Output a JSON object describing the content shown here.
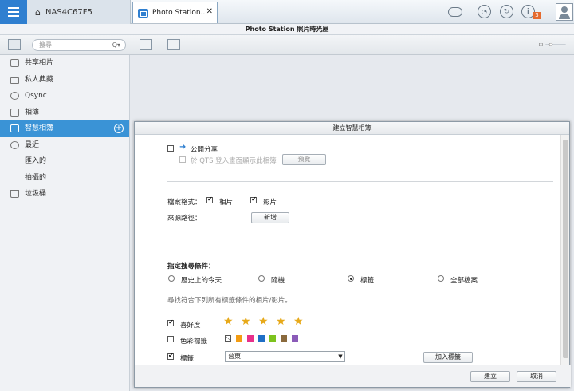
{
  "topbar": {
    "nas_name": "NAS4C67F5",
    "app_tab_label": "Photo Station...",
    "app_tab_close": "✕",
    "notification_count": "3"
  },
  "titlebar": {
    "title": "Photo Station 照片時光屋"
  },
  "toolbar": {
    "search_placeholder": "搜尋",
    "search_icon": "Q▾"
  },
  "sidebar": {
    "items": [
      {
        "label": "共享相片",
        "icon": "shared-photos-icon"
      },
      {
        "label": "私人典藏",
        "icon": "lock-icon"
      },
      {
        "label": "Qsync",
        "icon": "qsync-icon"
      },
      {
        "label": "相簿",
        "icon": "album-icon"
      },
      {
        "label": "智慧相簿",
        "icon": "smart-album-icon"
      },
      {
        "label": "最近",
        "icon": "clock-icon"
      },
      {
        "label": "匯入的"
      },
      {
        "label": "拍攝的"
      },
      {
        "label": "垃圾桶",
        "icon": "trash-icon"
      }
    ]
  },
  "dialog": {
    "title": "建立智慧相簿",
    "public_share_label": "公開分享",
    "qts_login_label": "於 QTS 登入畫面顯示此相簿",
    "preview_button": "預覽",
    "file_format_label": "檔案格式：",
    "photo_label": "相片",
    "video_label": "影片",
    "source_path_label": "來源路徑：",
    "add_button": "新增",
    "search_criteria_label": "指定搜尋條件：",
    "options": [
      "歷史上的今天",
      "隨機",
      "標籤",
      "全部檔案"
    ],
    "selected_option": "標籤",
    "hint": "尋找符合下列所有標籤條件的相片/影片。",
    "rating_label": "喜好度",
    "rating_value": 5,
    "color_tag_label": "色彩標籤",
    "color_swatches": [
      "#f39c12",
      "#e8308a",
      "#1f6fc6",
      "#7dc31e",
      "#8a6a3d",
      "#8b5bb8"
    ],
    "tag_label": "標籤",
    "tag_value": "台東",
    "add_tag_button": "加入標籤",
    "ok_button": "建立",
    "cancel_button": "取消"
  }
}
